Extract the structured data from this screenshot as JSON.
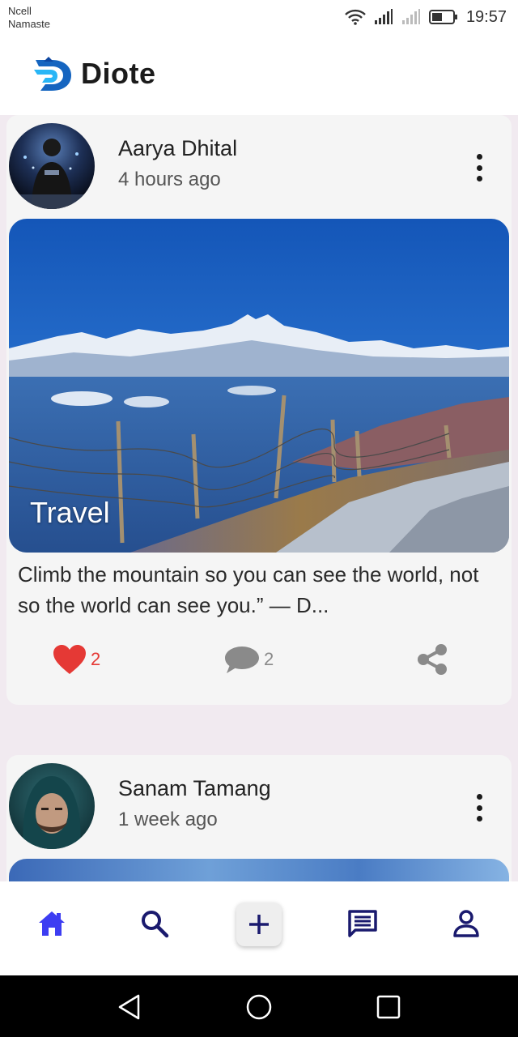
{
  "status_bar": {
    "carrier_line1": "Ncell",
    "carrier_line2": "Namaste",
    "time": "19:57",
    "icons": [
      "wifi-icon",
      "signal-icon",
      "signal-weak-icon",
      "battery-icon"
    ]
  },
  "app": {
    "name": "Diote",
    "logo_icon": "diote-logo-icon",
    "accent_color": "#1e88e5"
  },
  "posts": [
    {
      "author": "Aarya Dhital",
      "time": "4 hours ago",
      "category": "Travel",
      "caption": "Climb the mountain so you can see the world, not so the world can see you.” — D...",
      "likes": "2",
      "comments": "2",
      "liked": true
    },
    {
      "author": "Sanam Tamang",
      "time": "1 week ago"
    }
  ],
  "bottom_nav": {
    "items": [
      "home-icon",
      "search-icon",
      "add-icon",
      "chat-icon",
      "profile-icon"
    ],
    "active_color": "#3d3df2",
    "inactive_color": "#1a1a6e"
  },
  "colors": {
    "like": "#e53935",
    "muted": "#8a8a8a"
  }
}
